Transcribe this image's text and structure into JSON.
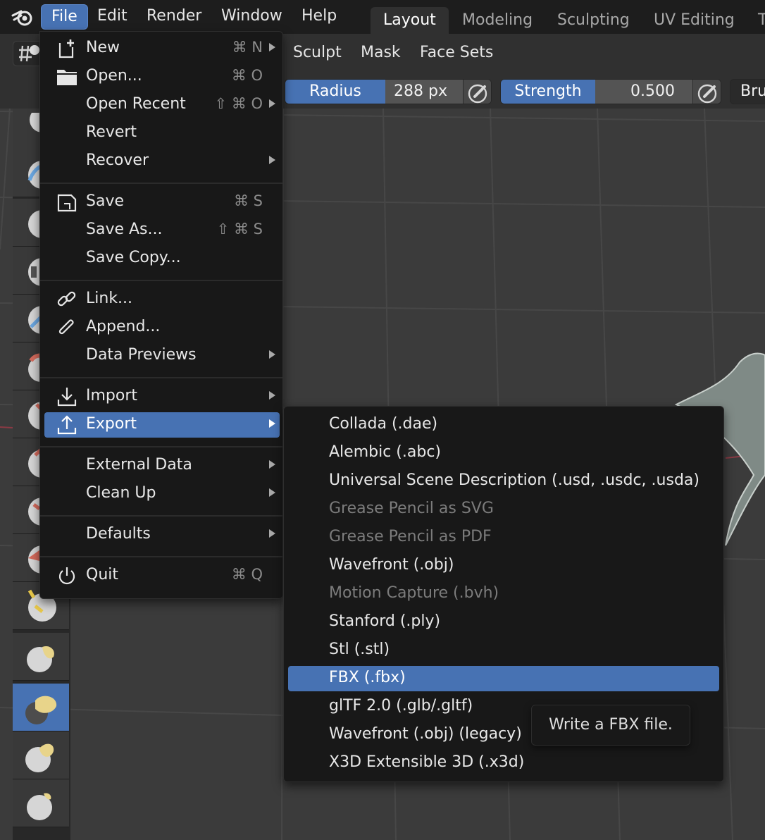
{
  "menubar": {
    "items": [
      {
        "label": "File",
        "active": true
      },
      {
        "label": "Edit"
      },
      {
        "label": "Render"
      },
      {
        "label": "Window"
      },
      {
        "label": "Help"
      }
    ],
    "workspaces": [
      {
        "label": "Layout",
        "active": true
      },
      {
        "label": "Modeling"
      },
      {
        "label": "Sculpting"
      },
      {
        "label": "UV Editing"
      },
      {
        "label": "T"
      }
    ]
  },
  "header": {
    "menus": [
      "Sculpt",
      "Mask",
      "Face Sets"
    ]
  },
  "tool_settings": {
    "radius": {
      "label": "Radius",
      "value": "288 px"
    },
    "strength": {
      "label": "Strength",
      "value": "0.500"
    },
    "brush_label": "Bru"
  },
  "file_menu": {
    "items": [
      {
        "label": "New",
        "shortcut": "⌘ N",
        "icon": "new-file-icon",
        "submenu": true
      },
      {
        "label": "Open...",
        "shortcut": "⌘ O",
        "icon": "folder-icon"
      },
      {
        "label": "Open Recent",
        "shortcut": "⇧ ⌘ O",
        "submenu": true
      },
      {
        "label": "Revert"
      },
      {
        "label": "Recover",
        "submenu": true
      },
      {
        "label": "Save",
        "shortcut": "⌘ S",
        "icon": "save-icon"
      },
      {
        "label": "Save As...",
        "shortcut": "⇧ ⌘ S"
      },
      {
        "label": "Save Copy..."
      },
      {
        "label": "Link...",
        "icon": "link-icon"
      },
      {
        "label": "Append...",
        "icon": "paperclip-icon"
      },
      {
        "label": "Data Previews",
        "submenu": true
      },
      {
        "label": "Import",
        "icon": "import-icon",
        "submenu": true
      },
      {
        "label": "Export",
        "icon": "export-icon",
        "submenu": true,
        "highlighted": true
      },
      {
        "label": "External Data",
        "submenu": true
      },
      {
        "label": "Clean Up",
        "submenu": true
      },
      {
        "label": "Defaults",
        "submenu": true
      },
      {
        "label": "Quit",
        "shortcut": "⌘ Q",
        "icon": "power-icon"
      }
    ]
  },
  "export_menu": {
    "items": [
      {
        "label": "Collada (.dae)"
      },
      {
        "label": "Alembic (.abc)"
      },
      {
        "label": "Universal Scene Description (.usd, .usdc, .usda)"
      },
      {
        "label": "Grease Pencil as SVG",
        "disabled": true
      },
      {
        "label": "Grease Pencil as PDF",
        "disabled": true
      },
      {
        "label": "Wavefront (.obj)"
      },
      {
        "label": "Motion Capture (.bvh)",
        "disabled": true
      },
      {
        "label": "Stanford (.ply)"
      },
      {
        "label": "Stl (.stl)"
      },
      {
        "label": "FBX (.fbx)",
        "highlighted": true
      },
      {
        "label": "glTF 2.0 (.glb/.gltf)"
      },
      {
        "label": "Wavefront (.obj) (legacy)"
      },
      {
        "label": "X3D Extensible 3D (.x3d)"
      }
    ]
  },
  "tooltip": {
    "text": "Write a FBX file."
  },
  "colors": {
    "accent": "#4772b3",
    "menu_bg": "#181818",
    "disabled_text": "#7c7c7c",
    "brush_yellow": "#e8d48a"
  }
}
